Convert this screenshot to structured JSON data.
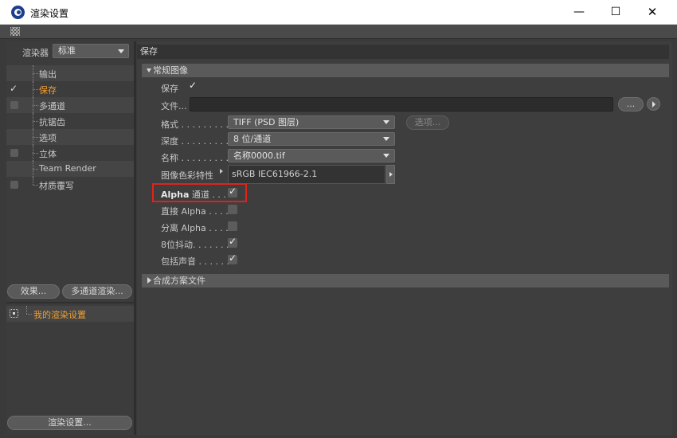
{
  "window": {
    "title": "渲染设置",
    "icon": "cinema4d-logo-icon",
    "minimize": "—",
    "maximize": "☐",
    "close": "✕"
  },
  "left": {
    "renderer_label": "渲染器",
    "renderer_value": "标准",
    "tree": [
      {
        "label": "输出",
        "checkbox": false,
        "checked": false,
        "active": false
      },
      {
        "label": "保存",
        "checkbox": false,
        "checked": true,
        "active": true
      },
      {
        "label": "多通道",
        "checkbox": true,
        "checked": false,
        "active": false
      },
      {
        "label": "抗锯齿",
        "checkbox": false,
        "checked": false,
        "active": false
      },
      {
        "label": "选项",
        "checkbox": false,
        "checked": false,
        "active": false
      },
      {
        "label": "立体",
        "checkbox": true,
        "checked": false,
        "active": false
      },
      {
        "label": "Team Render",
        "checkbox": false,
        "checked": false,
        "active": false
      },
      {
        "label": "材质覆写",
        "checkbox": true,
        "checked": false,
        "active": false
      }
    ],
    "effects_button": "效果...",
    "multipass_button": "多通道渲染...",
    "my_render_setting": "我的渲染设置",
    "render_settings_button": "渲染设置..."
  },
  "right": {
    "header": "保存",
    "general_section": "常规图像",
    "save_label": "保存",
    "save_checked": true,
    "file_label": "文件...",
    "file_value": "",
    "dots_button": "...",
    "format_label": "格式 . . . . . . . . .",
    "format_value": "TIFF (PSD 图层)",
    "options_button": "选项...",
    "depth_label": "深度 . . . . . . . . .",
    "depth_value": "8 位/通道",
    "name_label": "名称 . . . . . . . . .",
    "name_value": "名称0000.tif",
    "profile_label": "图像色彩特性",
    "profile_value": "sRGB IEC61966-2.1",
    "alpha_label_bold": "Alpha",
    "alpha_label_rest": " 通道 . . . .",
    "alpha_checked": true,
    "straight_alpha_label": "直接 Alpha . . . .",
    "straight_alpha_checked": false,
    "separate_alpha_label": "分离 Alpha . . . .",
    "separate_alpha_checked": false,
    "dither_label": "8位抖动. . . . . . .",
    "dither_checked": true,
    "sound_label": "包括声音 . . . . . .",
    "sound_checked": true,
    "compositing_section": "合成方案文件"
  }
}
